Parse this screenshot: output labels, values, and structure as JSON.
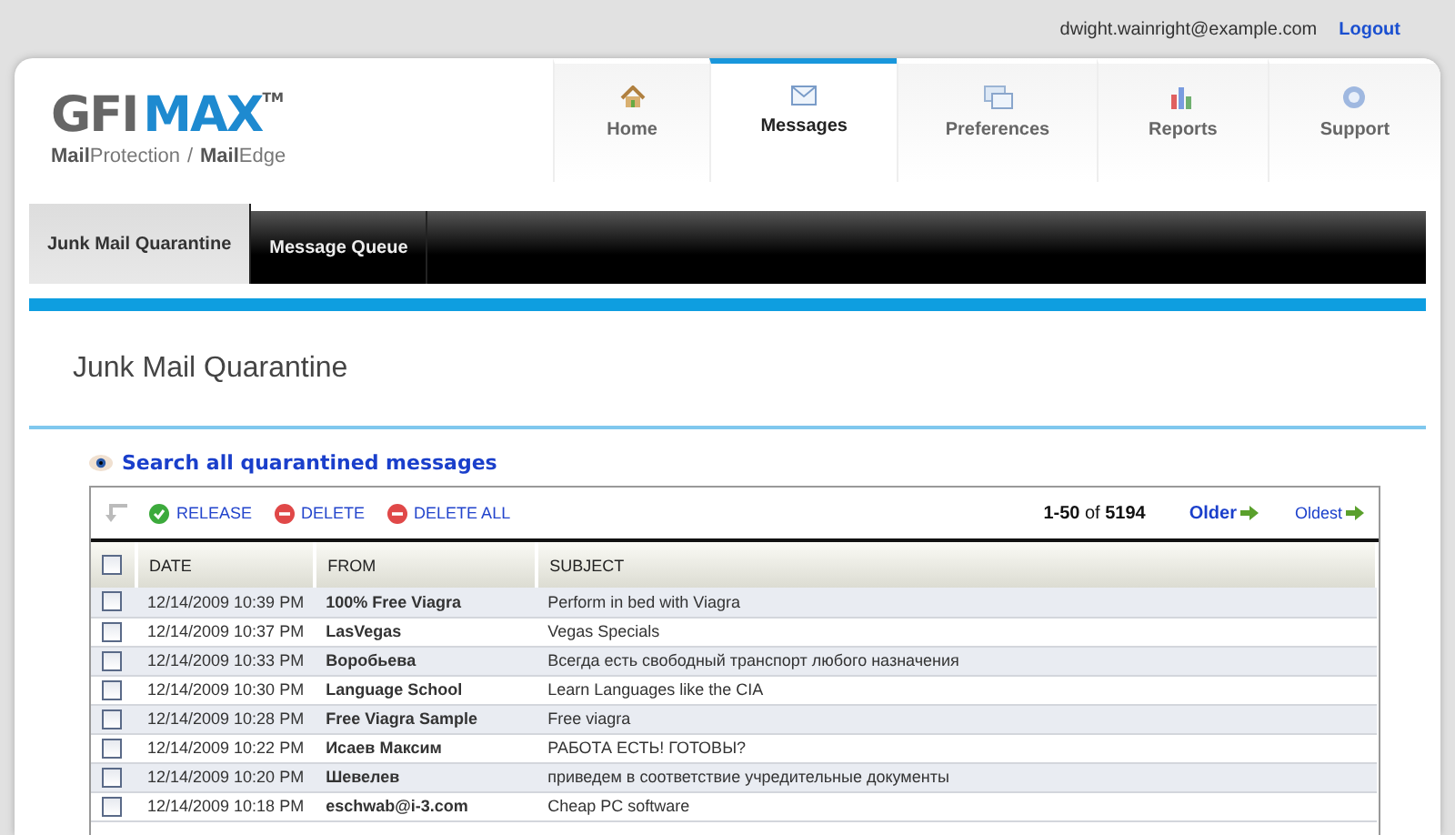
{
  "user": {
    "email": "dwight.wainright@example.com",
    "logout": "Logout"
  },
  "logo": {
    "gfi": "GFI",
    "max": "MAX",
    "tm": "TM",
    "product_1_bold": "Mail",
    "product_1": "Protection",
    "separator": "/",
    "product_2_bold": "Mail",
    "product_2": "Edge"
  },
  "nav": [
    {
      "label": "Home",
      "kind": "home",
      "selected": false
    },
    {
      "label": "Messages",
      "kind": "mail",
      "selected": true
    },
    {
      "label": "Preferences",
      "kind": "windows",
      "selected": false
    },
    {
      "label": "Reports",
      "kind": "chart",
      "selected": false
    },
    {
      "label": "Support",
      "kind": "help",
      "selected": false
    }
  ],
  "subnav": [
    {
      "label": "Junk Mail Quarantine",
      "selected": true
    },
    {
      "label": "Message Queue",
      "selected": false
    }
  ],
  "page_title": "Junk Mail Quarantine",
  "search_link": "Search all quarantined messages",
  "toolbar": {
    "actions": [
      {
        "label": "RELEASE",
        "kind": "release"
      },
      {
        "label": "DELETE",
        "kind": "delete"
      },
      {
        "label": "DELETE ALL",
        "kind": "delete"
      }
    ],
    "range": "1-50",
    "of": "of",
    "total": "5194",
    "older": "Older",
    "oldest": "Oldest"
  },
  "table": {
    "select_all_checked": false,
    "columns": [
      "DATE",
      "FROM",
      "SUBJECT"
    ],
    "rows": [
      {
        "checked": false,
        "date": "12/14/2009 10:39 PM",
        "from": "100% Free Viagra",
        "subject": "Perform in bed with Viagra"
      },
      {
        "checked": false,
        "date": "12/14/2009 10:37 PM",
        "from": "LasVegas",
        "subject": "Vegas Specials"
      },
      {
        "checked": false,
        "date": "12/14/2009 10:33 PM",
        "from": "Воробьева",
        "subject": "Всегда есть свободный транспорт любого назначения"
      },
      {
        "checked": false,
        "date": "12/14/2009 10:30 PM",
        "from": "Language School",
        "subject": "Learn Languages like the CIA"
      },
      {
        "checked": false,
        "date": "12/14/2009 10:28 PM",
        "from": "Free Viagra Sample",
        "subject": "Free viagra"
      },
      {
        "checked": false,
        "date": "12/14/2009 10:22 PM",
        "from": "Исаев Максим",
        "subject": "РАБОТА ЕСТЬ! ГОТОВЫ?"
      },
      {
        "checked": false,
        "date": "12/14/2009 10:20 PM",
        "from": "Шевелев",
        "subject": "приведем в соответствие учредительные документы"
      },
      {
        "checked": false,
        "date": "12/14/2009 10:18 PM",
        "from": "eschwab@i-3.com",
        "subject": "Cheap PC software"
      }
    ]
  }
}
